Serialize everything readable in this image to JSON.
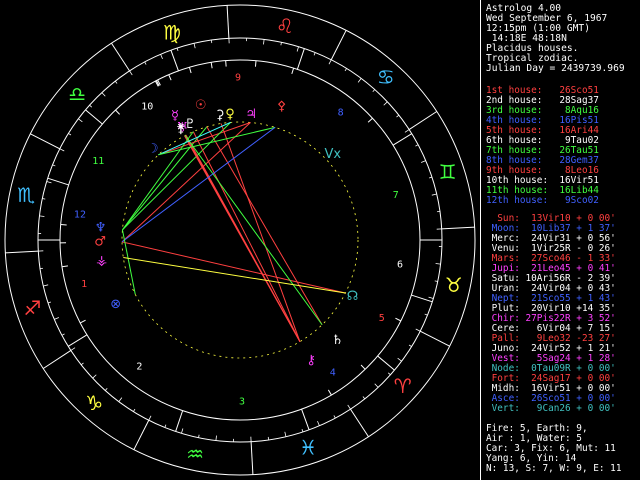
{
  "header": [
    "Astrolog 4.00",
    "Wed September 6, 1967",
    "12:15pm (1:00 GMT)",
    " 14:18E 48:18N",
    "Placidus houses.",
    "Tropical zodiac.",
    "Julian Day = 2439739.969"
  ],
  "houses": [
    {
      "label": "1st house:",
      "value": "26Sco51",
      "color": "#ff4040"
    },
    {
      "label": "2nd house:",
      "value": "28Sag37",
      "color": "#ffffff"
    },
    {
      "label": "3rd house:",
      "value": "8Aqu16",
      "color": "#40ff40"
    },
    {
      "label": "4th house:",
      "value": "16Pis51",
      "color": "#4060ff"
    },
    {
      "label": "5th house:",
      "value": "16Ari44",
      "color": "#ff4040"
    },
    {
      "label": "6th house:",
      "value": "9Tau02",
      "color": "#ffffff"
    },
    {
      "label": "7th house:",
      "value": "26Tau51",
      "color": "#40ff40"
    },
    {
      "label": "8th house:",
      "value": "28Gem37",
      "color": "#4060ff"
    },
    {
      "label": "9th house:",
      "value": "8Leo16",
      "color": "#ff4040"
    },
    {
      "label": "10th house:",
      "value": "16Vir51",
      "color": "#ffffff"
    },
    {
      "label": "11th house:",
      "value": "16Lib44",
      "color": "#40ff40"
    },
    {
      "label": "12th house:",
      "value": "9Sco02",
      "color": "#4060ff"
    }
  ],
  "planets": [
    {
      "name": "Sun:",
      "pos": "13Vir10",
      "speed": "+ 0 00'",
      "color": "#ff4040"
    },
    {
      "name": "Moon:",
      "pos": "10Lib37",
      "speed": "+ 1 37'",
      "color": "#4060ff"
    },
    {
      "name": "Merc:",
      "pos": "24Vir31",
      "speed": "+ 0 56'",
      "color": "#ffffff"
    },
    {
      "name": "Venu:",
      "pos": "1Vir25R",
      "speed": "- 0 26'",
      "color": "#ffffff"
    },
    {
      "name": "Mars:",
      "pos": "27Sco46",
      "speed": "- 1 33'",
      "color": "#ff4040"
    },
    {
      "name": "Jupi:",
      "pos": "21Leo45",
      "speed": "+ 0 41'",
      "color": "#ff40ff"
    },
    {
      "name": "Satu:",
      "pos": "10Ari56R",
      "speed": "- 2 39'",
      "color": "#ffffff"
    },
    {
      "name": "Uran:",
      "pos": "24Vir04",
      "speed": "+ 0 43'",
      "color": "#ffffff"
    },
    {
      "name": "Nept:",
      "pos": "21Sco55",
      "speed": "+ 1 43'",
      "color": "#4060ff"
    },
    {
      "name": "Plut:",
      "pos": "20Vir10",
      "speed": "+14 35'",
      "color": "#ffffff"
    },
    {
      "name": "Chir:",
      "pos": "27Pis22R",
      "speed": "+ 3 52'",
      "color": "#ff40ff"
    },
    {
      "name": "Cere:",
      "pos": "6Vir04",
      "speed": "+ 7 15'",
      "color": "#ffffff"
    },
    {
      "name": "Pall:",
      "pos": "9Leo32",
      "speed": "-23 27'",
      "color": "#ff4040"
    },
    {
      "name": "Juno:",
      "pos": "24Vir52",
      "speed": "+ 1 21'",
      "color": "#ffffff"
    },
    {
      "name": "Vest:",
      "pos": "5Sag24",
      "speed": "+ 1 28'",
      "color": "#ff40ff"
    },
    {
      "name": "Node:",
      "pos": "0Tau09R",
      "speed": "+ 0 00'",
      "color": "#40c0c0"
    },
    {
      "name": "Fort:",
      "pos": "24Sag17",
      "speed": "+ 0 00'",
      "color": "#ff4040"
    },
    {
      "name": "Midh:",
      "pos": "16Vir51",
      "speed": "+ 0 00'",
      "color": "#ffffff"
    },
    {
      "name": "Asce:",
      "pos": "26Sco51",
      "speed": "+ 0 00'",
      "color": "#4060ff"
    },
    {
      "name": "Vert:",
      "pos": "9Can26",
      "speed": "+ 0 00'",
      "color": "#40c0c0"
    }
  ],
  "summary": [
    "Fire: 5, Earth: 9,",
    "Air : 1, Water: 5",
    "Car: 3, Fix: 6, Mut: 11",
    "Yang: 6, Yin: 14",
    "N: 13, S: 7, W: 9, E: 11"
  ],
  "wheel": {
    "signs": [
      {
        "glyph": "♈",
        "deg": 0,
        "color": "#ff4040"
      },
      {
        "glyph": "♉",
        "deg": 30,
        "color": "#ffff40"
      },
      {
        "glyph": "♊",
        "deg": 60,
        "color": "#40ff40"
      },
      {
        "glyph": "♋",
        "deg": 90,
        "color": "#40c0ff"
      },
      {
        "glyph": "♌",
        "deg": 120,
        "color": "#ff4040"
      },
      {
        "glyph": "♍",
        "deg": 150,
        "color": "#ffff40"
      },
      {
        "glyph": "♎",
        "deg": 180,
        "color": "#40ff40"
      },
      {
        "glyph": "♏",
        "deg": 210,
        "color": "#40c0ff"
      },
      {
        "glyph": "♐",
        "deg": 240,
        "color": "#ff4040"
      },
      {
        "glyph": "♑",
        "deg": 270,
        "color": "#ffff40"
      },
      {
        "glyph": "♒",
        "deg": 300,
        "color": "#40ff40"
      },
      {
        "glyph": "♓",
        "deg": 330,
        "color": "#40c0ff"
      }
    ],
    "houses": [
      {
        "num": "1",
        "cusp": 236.85,
        "color": "#ff4040"
      },
      {
        "num": "2",
        "cusp": 268.62,
        "color": "#ffffff"
      },
      {
        "num": "3",
        "cusp": 308.27,
        "color": "#40ff40"
      },
      {
        "num": "4",
        "cusp": 346.85,
        "color": "#4060ff"
      },
      {
        "num": "5",
        "cusp": 16.73,
        "color": "#ff4040"
      },
      {
        "num": "6",
        "cusp": 39.03,
        "color": "#ffffff"
      },
      {
        "num": "7",
        "cusp": 56.85,
        "color": "#40ff40"
      },
      {
        "num": "8",
        "cusp": 88.62,
        "color": "#4060ff"
      },
      {
        "num": "9",
        "cusp": 128.27,
        "color": "#ff4040"
      },
      {
        "num": "10",
        "cusp": 166.85,
        "color": "#ffffff"
      },
      {
        "num": "11",
        "cusp": 196.73,
        "color": "#40ff40"
      },
      {
        "num": "12",
        "cusp": 219.03,
        "color": "#4060ff"
      }
    ],
    "planets": [
      {
        "glyph": "☉",
        "deg": 163.17,
        "color": "#ff4040"
      },
      {
        "glyph": "☽",
        "deg": 190.62,
        "color": "#4060ff"
      },
      {
        "glyph": "☿",
        "deg": 174.52,
        "color": "#ff40ff"
      },
      {
        "glyph": "♀",
        "deg": 151.42,
        "color": "#ffff40"
      },
      {
        "glyph": "♂",
        "deg": 237.77,
        "color": "#ff4040"
      },
      {
        "glyph": "♃",
        "deg": 141.75,
        "color": "#ff40ff"
      },
      {
        "glyph": "♄",
        "deg": 10.93,
        "color": "#ffffff"
      },
      {
        "glyph": "♅",
        "deg": 174.07,
        "color": "#ff40ff"
      },
      {
        "glyph": "♆",
        "deg": 231.92,
        "color": "#4060ff"
      },
      {
        "glyph": "♇",
        "deg": 170.17,
        "color": "#ffffff"
      },
      {
        "glyph": "⚷",
        "deg": 357.37,
        "color": "#ff40ff"
      },
      {
        "glyph": "⚳",
        "deg": 156.07,
        "color": "#ffffff"
      },
      {
        "glyph": "⚴",
        "deg": 129.53,
        "color": "#ff4040"
      },
      {
        "glyph": "⚵",
        "deg": 174.87,
        "color": "#ffffff"
      },
      {
        "glyph": "⚶",
        "deg": 245.4,
        "color": "#ff40ff"
      },
      {
        "glyph": "☊",
        "deg": 30.15,
        "color": "#40c0c0"
      },
      {
        "glyph": "⊗",
        "deg": 264.28,
        "color": "#4060ff"
      },
      {
        "glyph": "Vx",
        "deg": 99.43,
        "color": "#40c0c0"
      }
    ],
    "aspects": [
      {
        "a": 0,
        "b": 8,
        "color": "#40ff40"
      },
      {
        "a": 0,
        "b": 6,
        "color": "#ff4040"
      },
      {
        "a": 1,
        "b": 5,
        "color": "#ff4040"
      },
      {
        "a": 2,
        "b": 10,
        "color": "#ff4040"
      },
      {
        "a": 3,
        "b": 8,
        "color": "#40ff40"
      },
      {
        "a": 4,
        "b": 15,
        "color": "#ff4040"
      },
      {
        "a": 7,
        "b": 10,
        "color": "#ff4040"
      },
      {
        "a": 9,
        "b": 10,
        "color": "#ff4040"
      },
      {
        "a": 11,
        "b": 10,
        "color": "#ff4040"
      },
      {
        "a": 13,
        "b": 10,
        "color": "#ff4040"
      },
      {
        "a": 5,
        "b": 4,
        "color": "#ff4040"
      },
      {
        "a": 2,
        "b": 6,
        "color": "#40ff40"
      },
      {
        "a": 9,
        "b": 8,
        "color": "#40ff40"
      },
      {
        "a": 1,
        "b": 3,
        "color": "#40ffff"
      },
      {
        "a": 12,
        "b": 1,
        "color": "#40ff40"
      },
      {
        "a": 4,
        "b": 12,
        "color": "#4060ff"
      },
      {
        "a": 8,
        "b": 16,
        "color": "#40ff40"
      },
      {
        "a": 14,
        "b": 15,
        "color": "#ffff40"
      }
    ]
  }
}
